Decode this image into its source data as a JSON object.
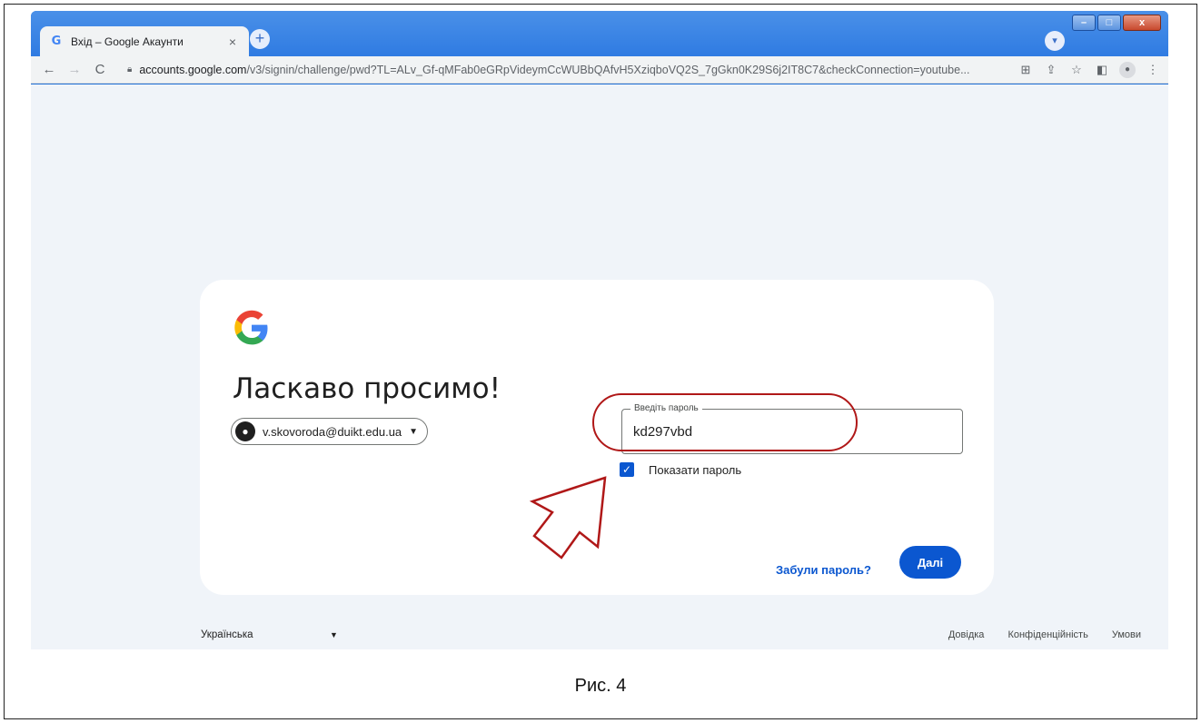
{
  "browser": {
    "tab": {
      "title": "Вхід – Google Акаунти",
      "favicon": "G",
      "close": "×"
    },
    "new_tab": "+",
    "window_controls": {
      "minimize": "–",
      "maximize": "□",
      "close": "x"
    },
    "nav": {
      "back": "←",
      "forward": "→",
      "reload": "C"
    },
    "url_host": "accounts.google.com",
    "url_path": "/v3/signin/challenge/pwd?TL=ALv_Gf-qMFab0eGRpVideymCcWUBbQAfvH5XziqboVQ2S_7gGkn0K29S6j2IT8C7&checkConnection=youtube..."
  },
  "signin": {
    "logo": "G",
    "heading": "Ласкаво просимо!",
    "account_email": "v.skovoroda@duikt.edu.ua",
    "password_label": "Введіть пароль",
    "password_value": "kd297vbd",
    "show_password_label": "Показати пароль",
    "show_password_checked": true,
    "forgot_password": "Забули пароль?",
    "next_button": "Далі"
  },
  "footer": {
    "language": "Українська",
    "links": [
      "Довідка",
      "Конфіденційність",
      "Умови"
    ]
  },
  "caption": "Рис. 4",
  "colors": {
    "primary_blue": "#0b57d0",
    "annotation_red": "#b01818",
    "page_background": "#f0f4f9"
  }
}
